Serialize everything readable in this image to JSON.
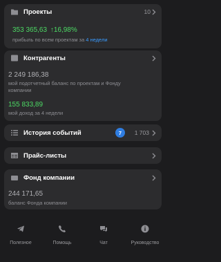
{
  "projects": {
    "title": "Проекты",
    "count": "10",
    "amount": "353 365,63",
    "change": "↑16,98%",
    "caption_prefix": "прибыль по всем проектам за",
    "caption_link": "4 недели"
  },
  "contractors": {
    "title": "Контрагенты",
    "balance": "2 249 186,38",
    "balance_caption": "мой подотчетный баланс по проектам и Фонду компании",
    "income": "155 833,89",
    "income_caption": "мой доход за 4 недели"
  },
  "history": {
    "title": "История событий",
    "badge": "7",
    "count": "1 703"
  },
  "pricelists": {
    "title": "Прайс-листы"
  },
  "fund": {
    "title": "Фонд компании",
    "amount": "244 171,65",
    "caption": "баланс Фонда компании"
  },
  "tabbar": {
    "tabs": [
      {
        "label": "Полезное",
        "icon": "telegram-icon"
      },
      {
        "label": "Помощь",
        "icon": "phone-icon"
      },
      {
        "label": "Чат",
        "icon": "chat-icon"
      },
      {
        "label": "Руководство",
        "icon": "info-icon"
      }
    ]
  },
  "colors": {
    "background": "#1c1c1e",
    "card": "#2c2c2e",
    "positive": "#4cd964",
    "link": "#3a9bff",
    "badge": "#2f7de1"
  }
}
